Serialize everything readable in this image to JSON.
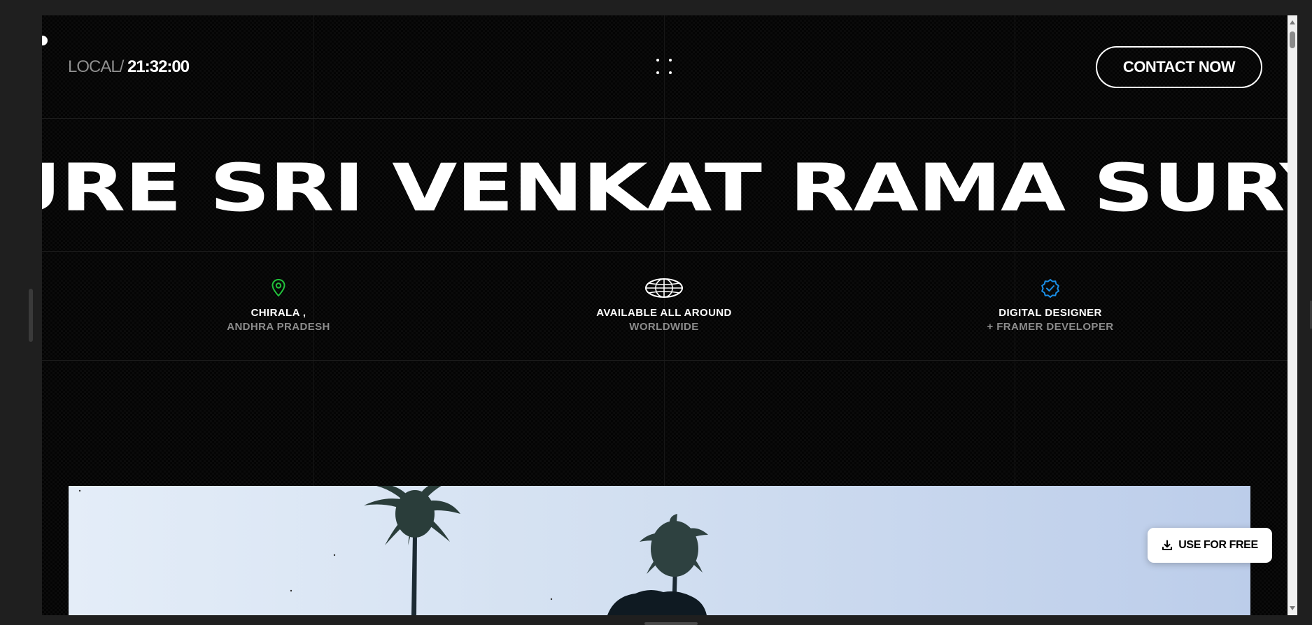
{
  "header": {
    "local_label": "LOCAL/",
    "local_time": "21:32:00",
    "menu_icon": "four-dots-menu-icon",
    "contact_label": "CONTACT NOW"
  },
  "hero": {
    "name": "SURE SRI VENKAT RAMA SURYA"
  },
  "info": [
    {
      "icon": "location-pin-icon",
      "icon_color": "#22c23c",
      "primary": "CHIRALA ,",
      "secondary": "ANDHRA PRADESH"
    },
    {
      "icon": "globe-icon",
      "icon_color": "#ffffff",
      "primary": "AVAILABLE ALL AROUND",
      "secondary": "WORLDWIDE"
    },
    {
      "icon": "verified-badge-icon",
      "icon_color": "#1a8fe8",
      "primary": "DIGITAL DESIGNER",
      "secondary": "+ FRAMER DEVELOPER"
    }
  ],
  "cta": {
    "use_free_label": "USE FOR FREE",
    "use_free_icon": "download-icon"
  },
  "colors": {
    "background": "#040404",
    "accent_green": "#22c23c",
    "accent_blue": "#1a8fe8"
  }
}
